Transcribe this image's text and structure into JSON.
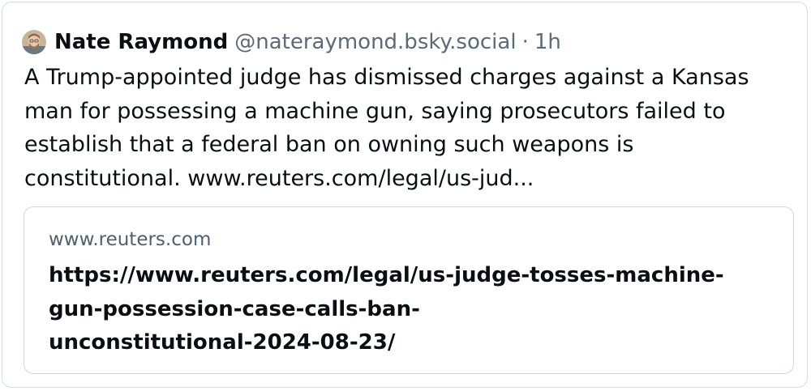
{
  "post": {
    "author": {
      "display_name": "Nate Raymond",
      "handle": "@nateraymond.bsky.social",
      "separator": "·",
      "time": "1h",
      "avatar_icon": "person-avatar"
    },
    "text": "A Trump-appointed judge has dismissed charges against a Kansas man for possessing a machine gun, saying prosecutors failed to establish that a federal ban on owning such weapons is constitutional.",
    "link_text": "www.reuters.com/legal/us-jud...",
    "embed": {
      "domain": "www.reuters.com",
      "title_lines": [
        "https://www.reuters.com/legal/us-judge-tosses-machine-",
        "gun-possession-case-calls-ban-",
        "unconstitutional-2024-08-23/"
      ]
    }
  },
  "colors": {
    "text": "#0b0f14",
    "muted": "#5b6a78",
    "border": "#d4dbe2"
  }
}
